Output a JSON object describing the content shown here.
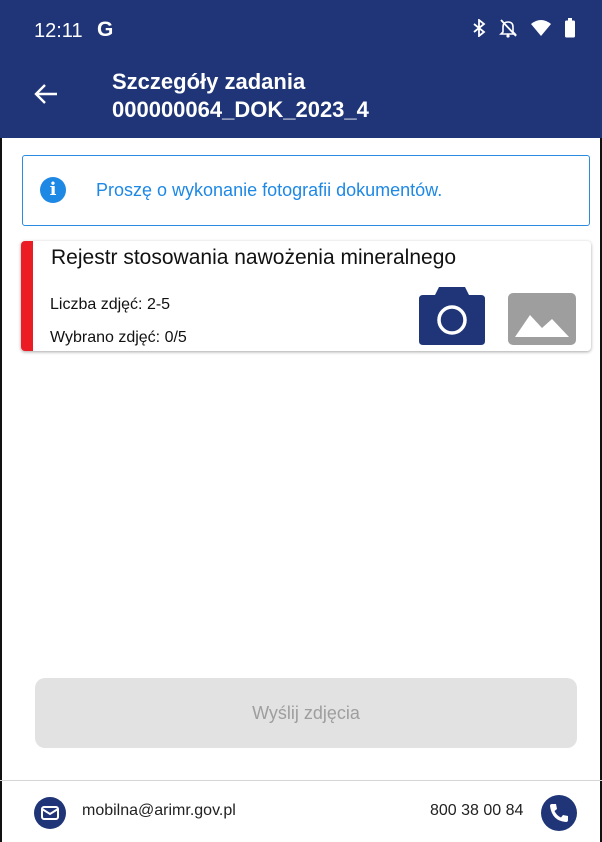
{
  "status_bar": {
    "time": "12:11",
    "g_label": "G"
  },
  "app_bar": {
    "title_line1": "Szczegóły zadania",
    "title_line2": "000000064_DOK_2023_4"
  },
  "info": {
    "icon_label": "i",
    "message": "Proszę o wykonanie fotografii dokumentów."
  },
  "document_card": {
    "title": "Rejestr stosowania nawożenia mineralnego",
    "photo_count_label": "Liczba zdjęć: 2-5",
    "selected_label": "Wybrano zdjęć: 0/5",
    "accent_color": "#ec1c24"
  },
  "send_button": {
    "label": "Wyślij zdjęcia",
    "enabled": false
  },
  "footer": {
    "email": "mobilna@arimr.gov.pl",
    "phone": "800 38 00 84"
  },
  "colors": {
    "primary": "#1f3577",
    "info": "#1e88e5",
    "disabled_bg": "#e2e2e2"
  },
  "icons": [
    "g-icon",
    "bluetooth-icon",
    "bell-off-icon",
    "wifi-icon",
    "battery-icon",
    "back-arrow-icon",
    "info-icon",
    "camera-icon",
    "gallery-icon",
    "email-icon",
    "phone-icon"
  ]
}
